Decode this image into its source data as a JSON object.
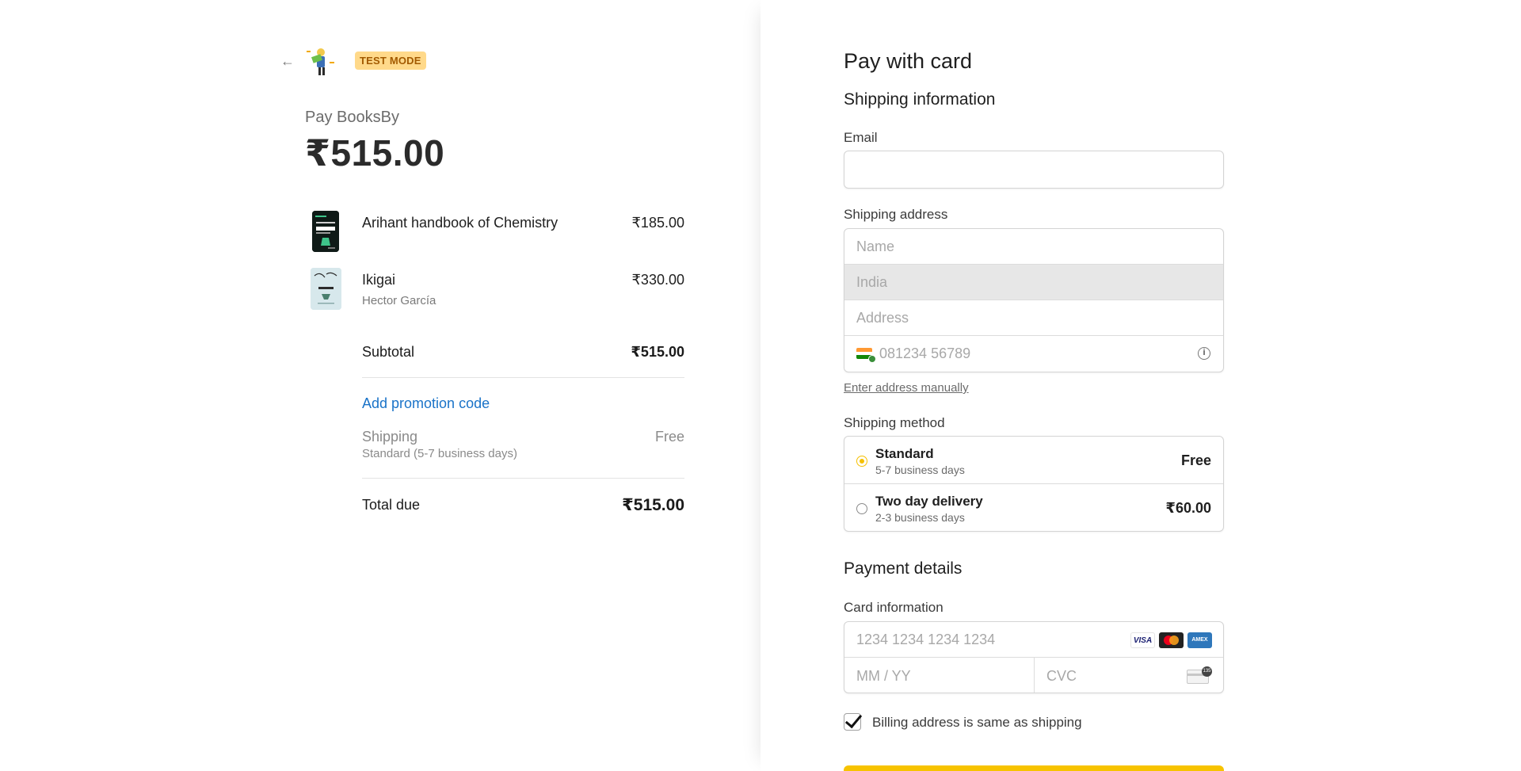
{
  "header": {
    "back_icon": "arrow-left-icon",
    "logo_icon": "bookstore-mascot-logo",
    "test_badge": "TEST MODE"
  },
  "summary": {
    "merchant_label": "Pay BooksBy",
    "total": "₹515.00",
    "items": [
      {
        "name": "Arihant handbook of Chemistry",
        "price": "₹185.00",
        "thumb": "chemistry-book-cover"
      },
      {
        "name": "Ikigai",
        "author": "Hector García",
        "price": "₹330.00",
        "thumb": "ikigai-book-cover"
      }
    ],
    "subtotal_label": "Subtotal",
    "subtotal_value": "₹515.00",
    "promo_link": "Add promotion code",
    "shipping_label": "Shipping",
    "shipping_desc": "Standard (5-7 business days)",
    "shipping_value": "Free",
    "total_due_label": "Total due",
    "total_due_value": "₹515.00"
  },
  "form": {
    "title": "Pay with card",
    "shipping_info_title": "Shipping information",
    "email_label": "Email",
    "email_value": "",
    "shipping_address_label": "Shipping address",
    "name_placeholder": "Name",
    "country_value": "India",
    "address_placeholder": "Address",
    "phone_placeholder": "081234 56789",
    "manual_link": "Enter address manually",
    "shipping_method_label": "Shipping method",
    "methods": [
      {
        "title": "Standard",
        "sub": "5-7 business days",
        "price": "Free",
        "selected": true
      },
      {
        "title": "Two day delivery",
        "sub": "2-3 business days",
        "price": "₹60.00",
        "selected": false
      }
    ],
    "payment_details_title": "Payment details",
    "card_info_label": "Card information",
    "card_number_placeholder": "1234 1234 1234 1234",
    "card_brands": [
      "VISA",
      "mastercard",
      "AMEX"
    ],
    "expiry_placeholder": "MM / YY",
    "cvc_placeholder": "CVC",
    "cvc_badge": "135",
    "billing_same_label": "Billing address is same as shipping",
    "billing_same_checked": true
  },
  "colors": {
    "accent": "#f7c300",
    "link": "#1a73c8",
    "badge_bg": "#ffd98a",
    "badge_text": "#a35a00"
  }
}
